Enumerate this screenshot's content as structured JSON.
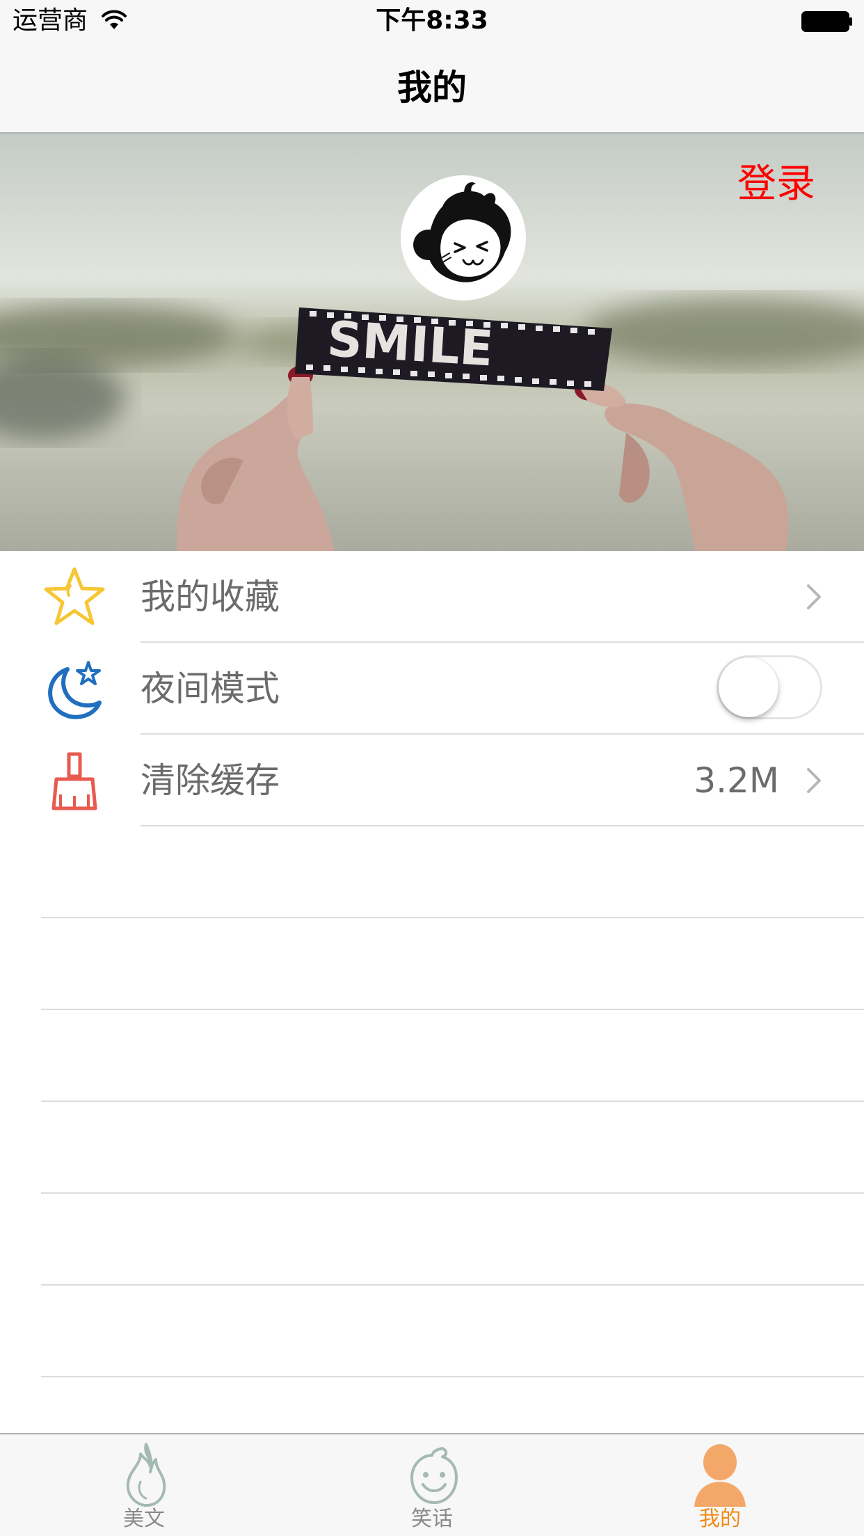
{
  "status_bar": {
    "carrier": "运营商",
    "time": "下午8:33",
    "wifi_icon": "wifi-icon",
    "battery_icon": "battery-full-icon"
  },
  "nav": {
    "title": "我的"
  },
  "header": {
    "login_label": "登录",
    "login_color": "#ff0000",
    "avatar_icon": "monkey-avatar-icon",
    "banner_text": "SMILE"
  },
  "settings": {
    "favorites": {
      "label": "我的收藏",
      "icon": "star-icon"
    },
    "night_mode": {
      "label": "夜间模式",
      "icon": "moon-star-icon",
      "enabled": false
    },
    "clear_cache": {
      "label": "清除缓存",
      "icon": "broom-icon",
      "value": "3.2M"
    }
  },
  "tabs": [
    {
      "label": "美文",
      "icon": "flame-icon",
      "active": false
    },
    {
      "label": "笑话",
      "icon": "smiley-face-icon",
      "active": false
    },
    {
      "label": "我的",
      "icon": "person-icon",
      "active": true
    }
  ],
  "colors": {
    "accent": "#f08a14",
    "tab_inactive": "#8a8a8a",
    "separator": "#dcdcdc"
  }
}
